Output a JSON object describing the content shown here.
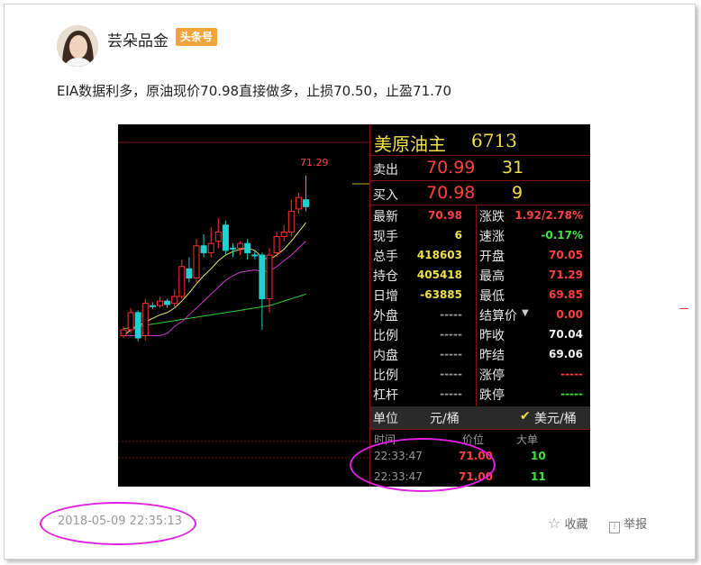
{
  "author": {
    "name": "芸朵品金",
    "badge": "头条号"
  },
  "post": {
    "text": "EIA数据利多，原油现价70.98直接做多，止损70.50，止盈71.70"
  },
  "quote": {
    "title": "美原油主",
    "code": "6713",
    "sell_label": "卖出",
    "sell_price": "70.99",
    "sell_qty": "31",
    "buy_label": "买入",
    "buy_price": "70.98",
    "buy_qty": "9",
    "rows": [
      {
        "l1": "最新",
        "v1": "70.98",
        "l2": "涨跌",
        "v2": "1.92/2.78%"
      },
      {
        "l1": "现手",
        "v1": "6",
        "l2": "速涨",
        "v2": "-0.17%"
      },
      {
        "l1": "总手",
        "v1": "418603",
        "l2": "开盘",
        "v2": "70.05"
      },
      {
        "l1": "持仓",
        "v1": "405418",
        "l2": "最高",
        "v2": "71.29"
      },
      {
        "l1": "日增",
        "v1": "-63885",
        "l2": "最低",
        "v2": "69.85"
      },
      {
        "l1": "外盘",
        "v1": "-----",
        "l2": "结算价",
        "v2": "0.00"
      },
      {
        "l1": "比例",
        "v1": "-----",
        "l2": "昨收",
        "v2": "70.04"
      },
      {
        "l1": "内盘",
        "v1": "-----",
        "l2": "昨结",
        "v2": "69.06"
      },
      {
        "l1": "比例",
        "v1": "-----",
        "l2": "涨停",
        "v2": "-----"
      },
      {
        "l1": "杠杆",
        "v1": "-----",
        "l2": "跌停",
        "v2": "-----"
      }
    ],
    "unit_label": "单位",
    "unit_value": "元/桶",
    "unit_currency": "美元/桶",
    "ticks_header": {
      "time": "时间",
      "price": "价位",
      "volume": "大单"
    },
    "ticks": [
      {
        "time": "22:33:47",
        "price": "71.00",
        "volume": "10"
      },
      {
        "time": "22:33:47",
        "price": "71.00",
        "volume": "11"
      }
    ]
  },
  "chart_data": {
    "type": "candlestick",
    "high_label": "71.29",
    "candles": [
      {
        "o": 69.9,
        "c": 69.95,
        "h": 69.98,
        "l": 69.88,
        "up": true
      },
      {
        "o": 69.95,
        "c": 70.1,
        "h": 70.14,
        "l": 69.92,
        "up": true
      },
      {
        "o": 70.1,
        "c": 69.88,
        "h": 70.12,
        "l": 69.85,
        "up": false
      },
      {
        "o": 69.9,
        "c": 70.18,
        "h": 70.22,
        "l": 69.86,
        "up": true
      },
      {
        "o": 70.16,
        "c": 70.16,
        "h": 70.19,
        "l": 70.13,
        "up": false
      },
      {
        "o": 70.16,
        "c": 70.2,
        "h": 70.24,
        "l": 70.14,
        "up": true
      },
      {
        "o": 70.2,
        "c": 70.17,
        "h": 70.22,
        "l": 70.14,
        "up": false
      },
      {
        "o": 70.18,
        "c": 70.24,
        "h": 70.3,
        "l": 70.15,
        "up": true
      },
      {
        "o": 70.24,
        "c": 70.5,
        "h": 70.56,
        "l": 70.22,
        "up": true
      },
      {
        "o": 70.48,
        "c": 70.4,
        "h": 70.58,
        "l": 70.36,
        "up": false
      },
      {
        "o": 70.4,
        "c": 70.68,
        "h": 70.74,
        "l": 70.36,
        "up": true
      },
      {
        "o": 70.68,
        "c": 70.62,
        "h": 70.78,
        "l": 70.58,
        "up": false
      },
      {
        "o": 70.62,
        "c": 70.7,
        "h": 70.84,
        "l": 70.58,
        "up": true
      },
      {
        "o": 70.72,
        "c": 70.8,
        "h": 70.92,
        "l": 70.66,
        "up": true
      },
      {
        "o": 70.86,
        "c": 70.64,
        "h": 70.9,
        "l": 70.6,
        "up": false
      },
      {
        "o": 70.66,
        "c": 70.66,
        "h": 70.7,
        "l": 70.58,
        "up": false
      },
      {
        "o": 70.66,
        "c": 70.7,
        "h": 70.72,
        "l": 70.6,
        "up": true
      },
      {
        "o": 70.7,
        "c": 70.62,
        "h": 70.74,
        "l": 70.56,
        "up": false
      },
      {
        "o": 70.6,
        "c": 70.6,
        "h": 70.64,
        "l": 70.56,
        "up": false
      },
      {
        "o": 70.6,
        "c": 70.22,
        "h": 70.62,
        "l": 69.95,
        "up": false
      },
      {
        "o": 70.22,
        "c": 70.6,
        "h": 70.66,
        "l": 70.1,
        "up": true
      },
      {
        "o": 70.62,
        "c": 70.76,
        "h": 70.8,
        "l": 70.58,
        "up": true
      },
      {
        "o": 70.76,
        "c": 70.8,
        "h": 70.86,
        "l": 70.72,
        "up": true
      },
      {
        "o": 70.8,
        "c": 70.98,
        "h": 71.08,
        "l": 70.76,
        "up": true
      },
      {
        "o": 71.0,
        "c": 71.1,
        "h": 71.14,
        "l": 70.96,
        "up": true
      },
      {
        "o": 71.08,
        "c": 71.02,
        "h": 71.29,
        "l": 70.98,
        "up": false
      }
    ],
    "ma_yellow": [
      69.9,
      69.95,
      69.98,
      70.02,
      70.05,
      70.08,
      70.1,
      70.14,
      70.2,
      70.27,
      70.35,
      70.42,
      70.48,
      70.55,
      70.6,
      70.63,
      70.65,
      70.66,
      70.64,
      70.58,
      70.56,
      70.6,
      70.65,
      70.72,
      70.8,
      70.88
    ],
    "ma_magenta": [
      69.9,
      69.9,
      69.9,
      69.9,
      69.9,
      69.9,
      69.92,
      69.98,
      70.02,
      70.08,
      70.14,
      70.2,
      70.26,
      70.32,
      70.38,
      70.42,
      70.45,
      70.46,
      70.47,
      70.46,
      70.46,
      70.5,
      70.55,
      70.6,
      70.66,
      70.72
    ],
    "ma_green": [
      69.96,
      69.97,
      69.98,
      69.99,
      70.0,
      70.01,
      70.02,
      70.03,
      70.04,
      70.05,
      70.06,
      70.07,
      70.08,
      70.09,
      70.1,
      70.11,
      70.12,
      70.13,
      70.14,
      70.15,
      70.16,
      70.18,
      70.2,
      70.22,
      70.24,
      70.26
    ],
    "ylim": [
      69.7,
      71.5
    ]
  },
  "meta": {
    "date": "2018-05-09 22:35:13",
    "collect_label": "收藏",
    "report_label": "举报"
  }
}
